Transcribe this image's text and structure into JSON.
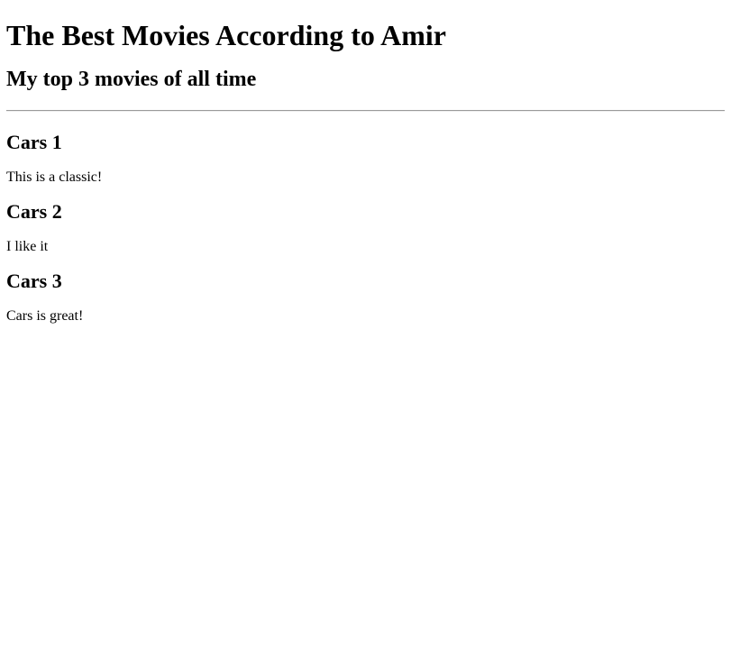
{
  "page": {
    "title": "The Best Movies According to Amir",
    "subtitle": "My top 3 movies of all time"
  },
  "movies": [
    {
      "title": "Cars 1",
      "description": "This is a classic!"
    },
    {
      "title": "Cars 2",
      "description": "I like it"
    },
    {
      "title": "Cars 3",
      "description": "Cars is great!"
    }
  ]
}
